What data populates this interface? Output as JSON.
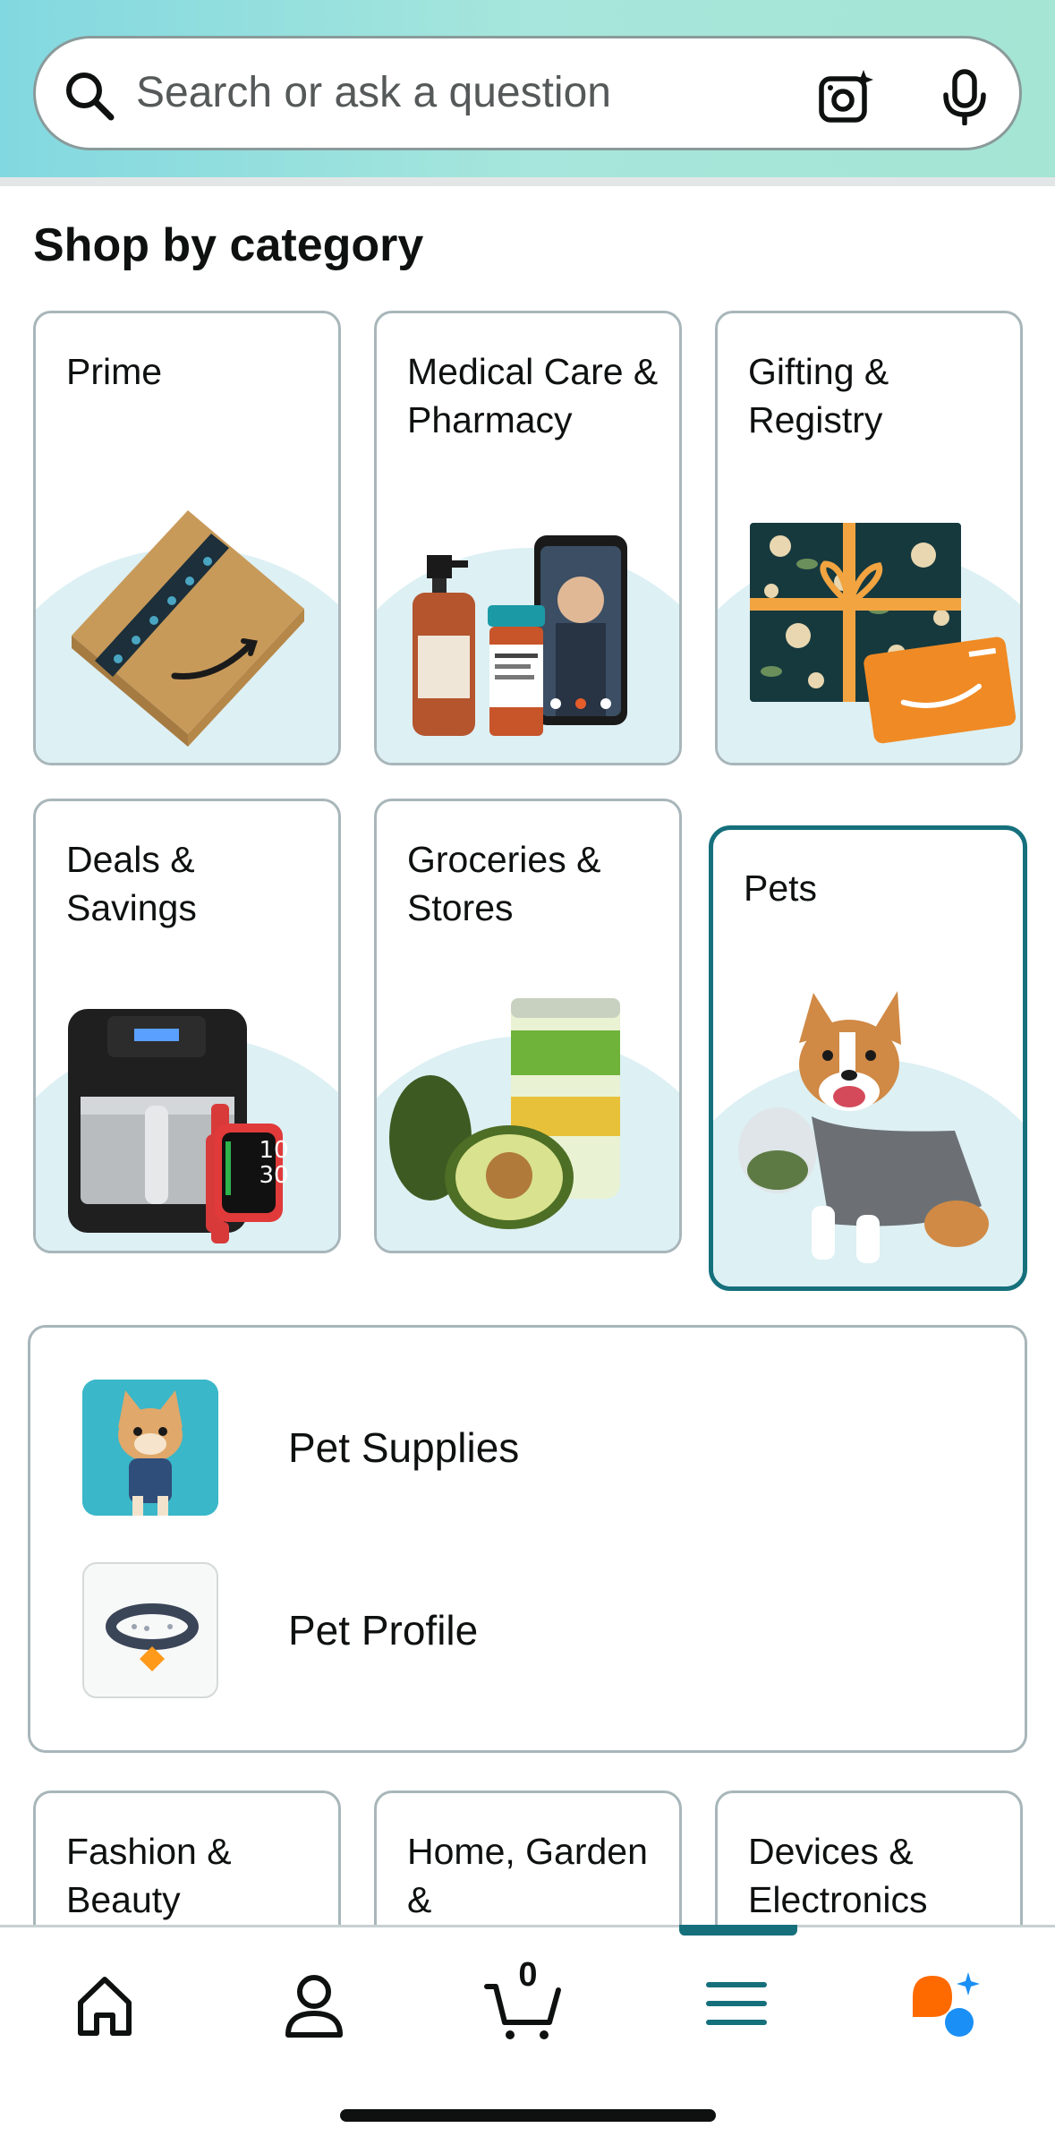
{
  "search": {
    "placeholder": "Search or ask a question",
    "icons": [
      "search-icon",
      "camera-sparkle-icon",
      "microphone-icon"
    ]
  },
  "section_title": "Shop by category",
  "categories": [
    {
      "label": "Prime"
    },
    {
      "label": "Medical Care & Pharmacy"
    },
    {
      "label": "Gifting & Registry"
    },
    {
      "label": "Deals & Savings"
    },
    {
      "label": "Groceries & Stores"
    },
    {
      "label": "Pets",
      "selected": true
    },
    {
      "label": "Fashion & Beauty"
    },
    {
      "label": "Home, Garden &"
    },
    {
      "label": "Devices & Electronics"
    }
  ],
  "pets_menu": {
    "items": [
      {
        "label": "Pet Supplies",
        "icon": "dog-photo"
      },
      {
        "label": "Pet Profile",
        "icon": "pet-collar-icon"
      }
    ]
  },
  "bottom_nav": {
    "items": [
      "home-icon",
      "account-icon",
      "cart-icon",
      "menu-icon",
      "rufus-assistant-icon"
    ],
    "cart_count": "0",
    "active": "menu-icon"
  },
  "colors": {
    "accent": "#15707c",
    "header_gradient_start": "#82d8e0",
    "header_gradient_end": "#a5e5d4",
    "tile_arc": "#ddf0f4",
    "rufus_orange": "#ff6a00",
    "rufus_blue": "#1a8ff5"
  }
}
